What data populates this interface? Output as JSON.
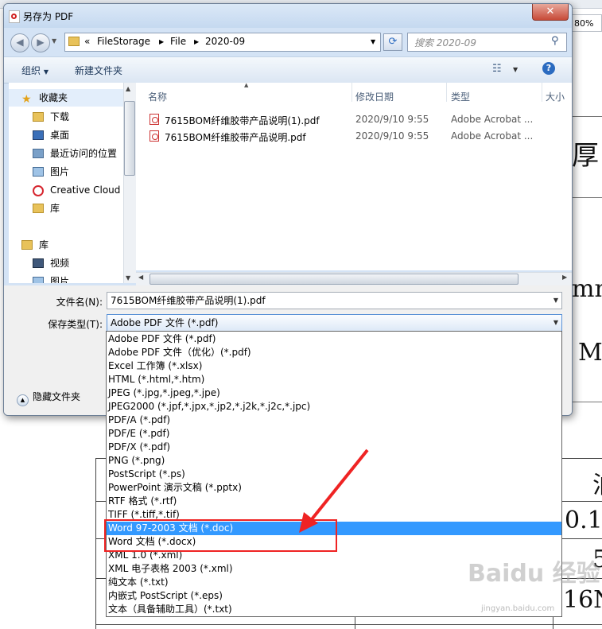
{
  "dialog": {
    "title": "另存为 PDF",
    "close_label": "✕",
    "path": {
      "prefix": "«",
      "segments": [
        "FileStorage",
        "File",
        "2020-09"
      ]
    },
    "search_placeholder": "搜索 2020-09",
    "toolbar": {
      "organize": "组织",
      "new_folder": "新建文件夹"
    },
    "nav": {
      "favorites_header": "收藏夹",
      "items": [
        "下载",
        "桌面",
        "最近访问的位置",
        "图片",
        "Creative Cloud",
        "库"
      ],
      "library_header": "库",
      "library_items": [
        "视频",
        "图片"
      ]
    },
    "columns": [
      "名称",
      "修改日期",
      "类型",
      "大小"
    ],
    "files": [
      {
        "name": "7615BOM纤维胶带产品说明(1).pdf",
        "date": "2020/9/10 9:55",
        "type": "Adobe Acrobat ..."
      },
      {
        "name": "7615BOM纤维胶带产品说明.pdf",
        "date": "2020/9/10 9:55",
        "type": "Adobe Acrobat ..."
      }
    ],
    "filename_label": "文件名(N):",
    "filename_value": "7615BOM纤维胶带产品说明(1).pdf",
    "filetype_label": "保存类型(T):",
    "filetype_value": "Adobe PDF 文件 (*.pdf)",
    "hide_folders": "隐藏文件夹",
    "filetype_options": [
      "Adobe PDF 文件 (*.pdf)",
      "Adobe PDF 文件（优化）(*.pdf)",
      "Excel 工作簿 (*.xlsx)",
      "HTML (*.html,*.htm)",
      "JPEG (*.jpg,*.jpeg,*.jpe)",
      "JPEG2000 (*.jpf,*.jpx,*.jp2,*.j2k,*.j2c,*.jpc)",
      "PDF/A (*.pdf)",
      "PDF/E (*.pdf)",
      "PDF/X (*.pdf)",
      "PNG (*.png)",
      "PostScript (*.ps)",
      "PowerPoint 演示文稿 (*.pptx)",
      "RTF 格式 (*.rtf)",
      "TIFF (*.tiff,*.tif)",
      "Word 97-2003 文档 (*.doc)",
      "Word 文档 (*.docx)",
      "XML 1.0 (*.xml)",
      "XML 电子表格 2003 (*.xml)",
      "纯文本 (*.txt)",
      "内嵌式 PostScript (*.eps)",
      "文本（具备辅助工具）(*.txt)"
    ],
    "highlighted_option": "Word 97-2003 文档 (*.doc)"
  },
  "background": {
    "zoom": "80%",
    "doc_fragments": [
      "厚",
      "mm",
      "M",
      "泊",
      "0.1",
      "5",
      "16N"
    ]
  },
  "watermark": {
    "brand": "Baidu 经验",
    "url": "jingyan.baidu.com"
  },
  "colors": {
    "highlight": "#3399ff",
    "annotation_red": "#ef2323"
  }
}
